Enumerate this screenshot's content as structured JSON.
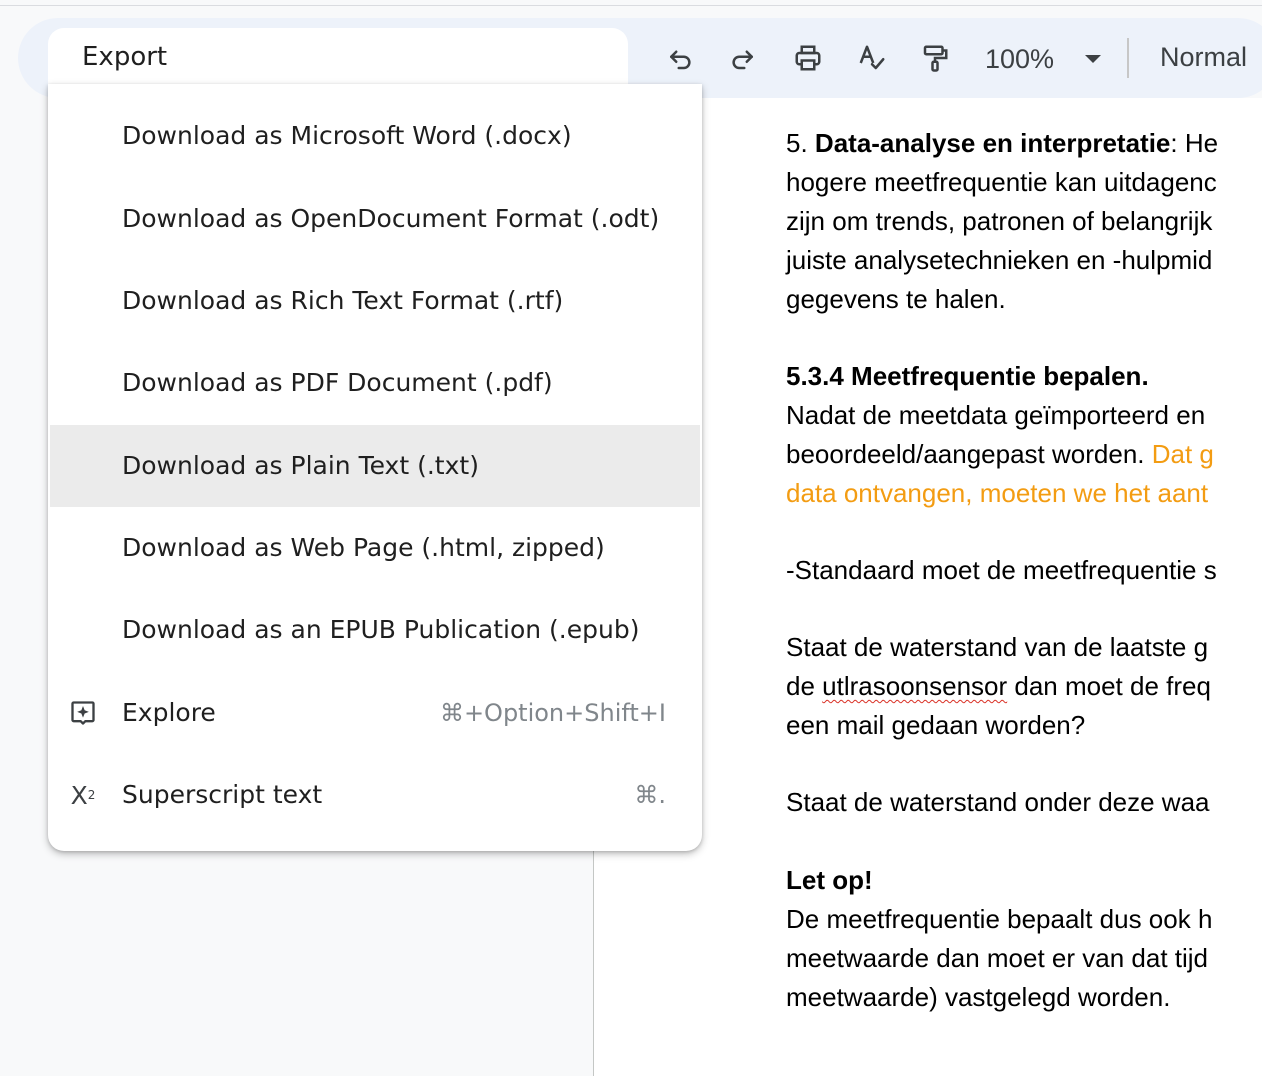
{
  "search": {
    "value": "Export"
  },
  "toolbar": {
    "zoom": "100%",
    "style": "Normal"
  },
  "menu_items": [
    {
      "label": "Download as Microsoft Word (.docx)"
    },
    {
      "label": "Download as OpenDocument Format (.odt)"
    },
    {
      "label": "Download as Rich Text Format (.rtf)"
    },
    {
      "label": "Download as PDF Document (.pdf)"
    },
    {
      "label": "Download as Plain Text (.txt)"
    },
    {
      "label": "Download as Web Page (.html, zipped)"
    },
    {
      "label": "Download as an EPUB Publication (.epub)"
    },
    {
      "label": "Explore",
      "icon": "explore-icon",
      "shortcut": "⌘+Option+Shift+I"
    },
    {
      "label": "Superscript text",
      "icon": "superscript-icon",
      "shortcut": "⌘."
    }
  ],
  "document": {
    "p1": {
      "prefix": "5. ",
      "bold": "Data-analyse en interpretatie",
      "rest": ": He",
      "lines": [
        "hogere meetfrequentie kan uitdagenc",
        "zijn om trends, patronen of belangrijk",
        "juiste analysetechnieken en -hulpmid",
        "gegevens te halen."
      ]
    },
    "heading": "5.3.4 Meetfrequentie bepalen.",
    "p2": {
      "line1": "Nadat de meetdata geïmporteerd en",
      "line2_plain": "beoordeeld/aangepast worden. ",
      "line2_orange": "Dat g",
      "line3_orange": "data ontvangen, moeten we het aant"
    },
    "p3": "-Standaard moet de meetfrequentie s",
    "p4": {
      "line1": "Staat de waterstand van de laatste g",
      "line2_pre": "de ",
      "line2_misspelled": "utlrasoonsensor",
      "line2_post": " dan moet de freq",
      "line3": "een mail gedaan worden?"
    },
    "p5": "Staat de waterstand onder deze waa",
    "p6": {
      "bold": "Let op!",
      "lines": [
        "De meetfrequentie bepaalt dus ook h",
        "meetwaarde dan moet er van dat tijd",
        "meetwaarde) vastgelegd worden."
      ]
    }
  }
}
